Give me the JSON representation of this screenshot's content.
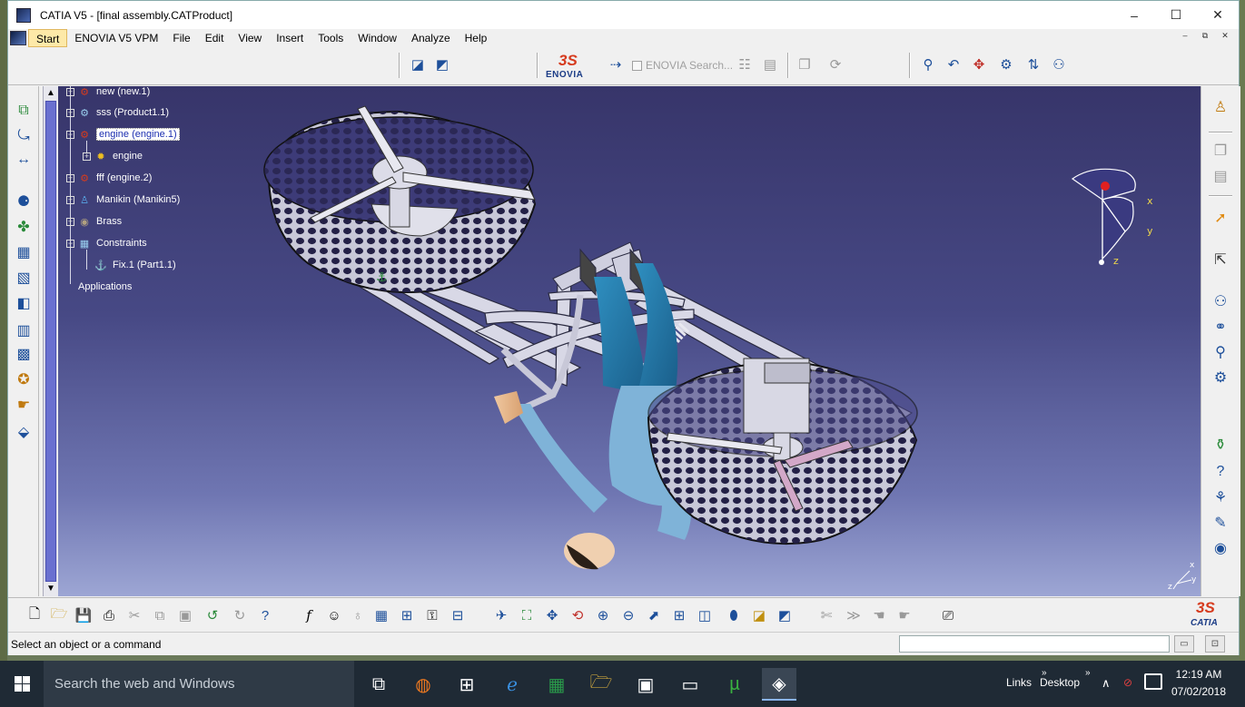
{
  "window": {
    "title": "CATIA V5 - [final assembly.CATProduct]",
    "minimize": "–",
    "maximize": "☐",
    "close": "✕"
  },
  "menubar": {
    "items": [
      "Start",
      "ENOVIA V5 VPM",
      "File",
      "Edit",
      "View",
      "Insert",
      "Tools",
      "Window",
      "Analyze",
      "Help"
    ],
    "mdi_minimize": "–",
    "mdi_restore": "⧉",
    "mdi_close": "✕"
  },
  "toolbar": {
    "enovia_logo_ds": "3S",
    "enovia_logo_text": "ENOVIA",
    "enovia_search_label": "ENOVIA Search..."
  },
  "tree": {
    "nodes": [
      {
        "label": "new (new.1)",
        "icon": "product-icon"
      },
      {
        "label": "sss (Product1.1)",
        "icon": "product-icon"
      },
      {
        "label": "engine (engine.1)",
        "icon": "product-icon",
        "selected": true
      },
      {
        "label": "engine",
        "icon": "gear-part-icon"
      },
      {
        "label": "fff (engine.2)",
        "icon": "product-icon"
      },
      {
        "label": "Manikin (Manikin5)",
        "icon": "manikin-icon"
      },
      {
        "label": "Brass",
        "icon": "material-icon"
      },
      {
        "label": "Constraints",
        "icon": "constraints-icon"
      },
      {
        "label": "Fix.1 (Part1.1)",
        "icon": "fix-constraint-icon"
      },
      {
        "label": "Applications",
        "icon": ""
      }
    ]
  },
  "compass": {
    "x_label": "x",
    "y_label": "y",
    "z_label": "z"
  },
  "axis_small": {
    "x_label": "x",
    "y_label": "y",
    "z_label": "z"
  },
  "catia_logo": {
    "ds": "3S",
    "text": "CATIA"
  },
  "statusbar": {
    "message": "Select an object or a command",
    "command_input": ""
  },
  "taskbar": {
    "search_placeholder": "Search the web and Windows",
    "links_label": "Links",
    "desktop_label": "Desktop",
    "time": "12:19 AM",
    "date": "07/02/2018"
  },
  "colors": {
    "viewport_top": "#37356a",
    "viewport_bottom": "#9da6d4",
    "selection": "#1c2fb0",
    "taskbar": "#1f2a35"
  }
}
